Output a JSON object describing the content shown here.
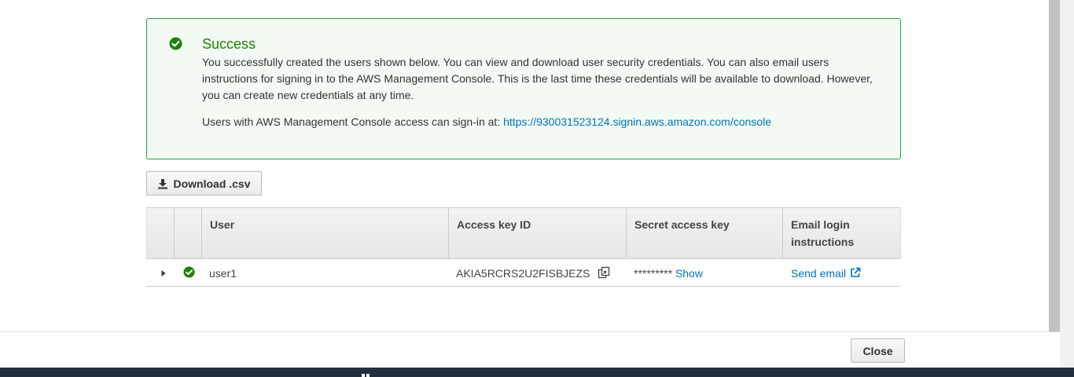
{
  "alert": {
    "icon": "check-circle-icon",
    "title": "Success",
    "body": "You successfully created the users shown below. You can view and download user security credentials. You can also email users instructions for signing in to the AWS Management Console. This is the last time these credentials will be available to download. However, you can create new credentials at any time.",
    "signin_prefix": "Users with AWS Management Console access can sign-in at: ",
    "signin_url": "https://930031523124.signin.aws.amazon.com/console",
    "accent_color": "#1d8102"
  },
  "toolbar": {
    "download_label": "Download .csv",
    "download_icon": "download-icon"
  },
  "table": {
    "headers": {
      "user": "User",
      "access_key_id": "Access key ID",
      "secret_access_key": "Secret access key",
      "email_line1": "Email login",
      "email_line2": "instructions"
    },
    "rows": [
      {
        "user": "user1",
        "access_key_id": "AKIA5RCRS2U2FISBJEZS",
        "secret_masked": "*********",
        "show_label": "Show",
        "email_label": "Send email"
      }
    ]
  },
  "footer": {
    "close_label": "Close"
  },
  "colors": {
    "link": "#0073bb",
    "success": "#1d8102",
    "bottom_bar": "#232f3e"
  }
}
